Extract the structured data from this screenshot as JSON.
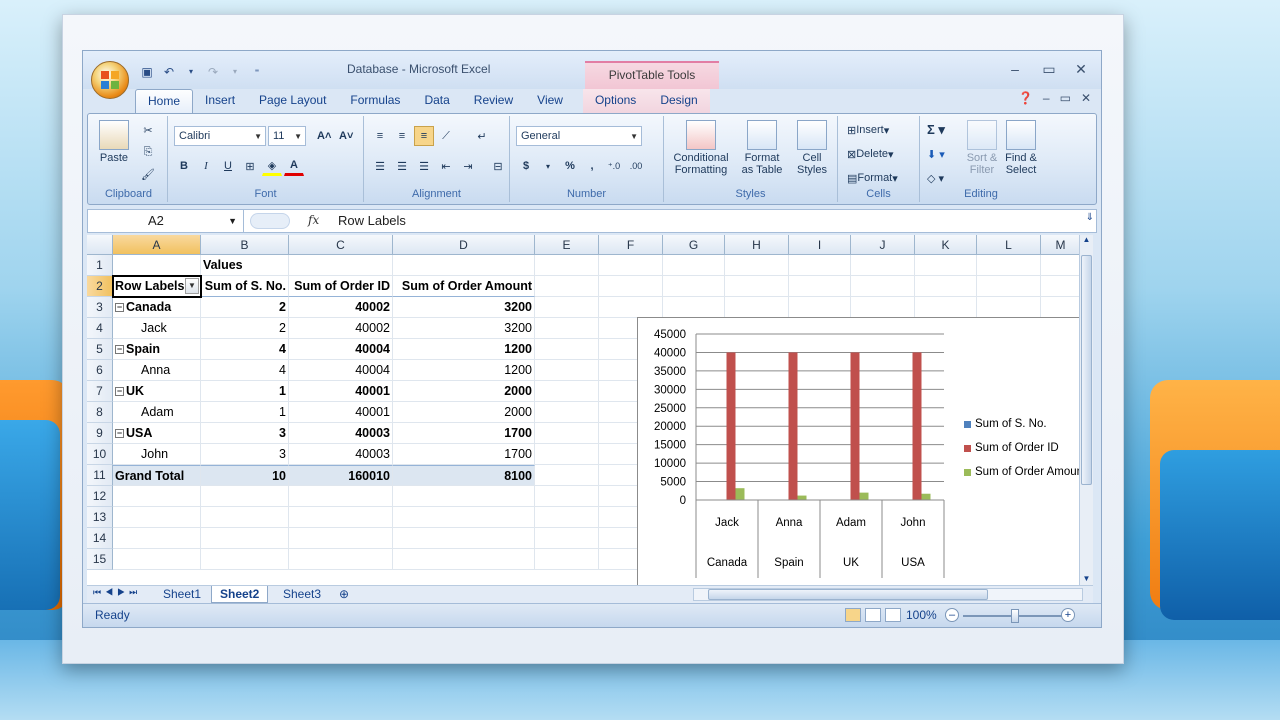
{
  "window": {
    "title": "Database - Microsoft Excel",
    "contextual_tab_group": "PivotTable Tools"
  },
  "tabs": [
    "Home",
    "Insert",
    "Page Layout",
    "Formulas",
    "Data",
    "Review",
    "View",
    "Options",
    "Design"
  ],
  "ribbon": {
    "clipboard": {
      "label": "Clipboard",
      "paste": "Paste"
    },
    "font": {
      "label": "Font",
      "name": "Calibri",
      "size": "11"
    },
    "alignment": {
      "label": "Alignment"
    },
    "number": {
      "label": "Number",
      "format": "General",
      "currency": "$",
      "percent": "%",
      "comma": ","
    },
    "styles": {
      "label": "Styles",
      "conditional": [
        "Conditional",
        "Formatting"
      ],
      "format_table": [
        "Format",
        "as Table"
      ],
      "cell_styles": [
        "Cell",
        "Styles"
      ]
    },
    "cells": {
      "label": "Cells",
      "insert": "Insert",
      "delete": "Delete",
      "format": "Format"
    },
    "editing": {
      "label": "Editing",
      "sort": [
        "Sort &",
        "Filter"
      ],
      "find": [
        "Find &",
        "Select"
      ]
    }
  },
  "formula_bar": {
    "name_box": "A2",
    "fx": "fx",
    "value": "Row Labels"
  },
  "columns": [
    "A",
    "B",
    "C",
    "D",
    "E",
    "F",
    "G",
    "H",
    "I",
    "J",
    "K",
    "L",
    "M"
  ],
  "rows": [
    "1",
    "2",
    "3",
    "4",
    "5",
    "6",
    "7",
    "8",
    "9",
    "10",
    "11",
    "12",
    "13",
    "14",
    "15"
  ],
  "pivot": {
    "values_label": "Values",
    "headers": [
      "Row Labels",
      "Sum of S. No.",
      "Sum of Order ID",
      "Sum of Order Amount"
    ],
    "rows": [
      {
        "label": "Canada",
        "sno": "2",
        "oid": "40002",
        "amt": "3200",
        "group": true
      },
      {
        "label": "Jack",
        "sno": "2",
        "oid": "40002",
        "amt": "3200",
        "group": false
      },
      {
        "label": "Spain",
        "sno": "4",
        "oid": "40004",
        "amt": "1200",
        "group": true
      },
      {
        "label": "Anna",
        "sno": "4",
        "oid": "40004",
        "amt": "1200",
        "group": false
      },
      {
        "label": "UK",
        "sno": "1",
        "oid": "40001",
        "amt": "2000",
        "group": true
      },
      {
        "label": "Adam",
        "sno": "1",
        "oid": "40001",
        "amt": "2000",
        "group": false
      },
      {
        "label": "USA",
        "sno": "3",
        "oid": "40003",
        "amt": "1700",
        "group": true
      },
      {
        "label": "John",
        "sno": "3",
        "oid": "40003",
        "amt": "1700",
        "group": false
      }
    ],
    "total": {
      "label": "Grand Total",
      "sno": "10",
      "oid": "160010",
      "amt": "8100"
    }
  },
  "chart_data": {
    "type": "bar",
    "categories": [
      "Jack",
      "Anna",
      "Adam",
      "John"
    ],
    "category_groups": [
      "Canada",
      "Spain",
      "UK",
      "USA"
    ],
    "series": [
      {
        "name": "Sum of S. No.",
        "values": [
          2,
          4,
          1,
          3
        ],
        "color": "#4f81bd"
      },
      {
        "name": "Sum of Order ID",
        "values": [
          40002,
          40004,
          40001,
          40003
        ],
        "color": "#c0504d"
      },
      {
        "name": "Sum of Order Amount",
        "values": [
          3200,
          1200,
          2000,
          1700
        ],
        "color": "#9bbb59"
      }
    ],
    "ylim": [
      0,
      45000
    ],
    "yticks": [
      "0",
      "5000",
      "10000",
      "15000",
      "20000",
      "25000",
      "30000",
      "35000",
      "40000",
      "45000"
    ],
    "legend": "right",
    "grid": true
  },
  "sheet_tabs": [
    "Sheet1",
    "Sheet2",
    "Sheet3"
  ],
  "active_sheet": "Sheet2",
  "status": {
    "text": "Ready",
    "zoom": "100%"
  }
}
